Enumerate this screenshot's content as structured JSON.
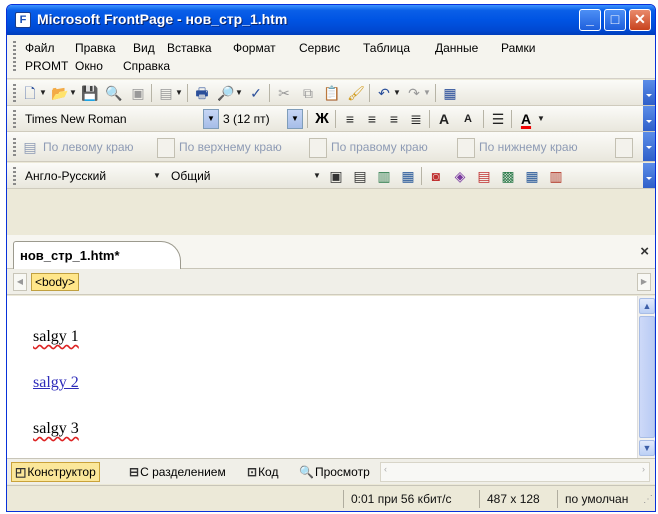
{
  "window": {
    "title": "Microsoft FrontPage - нов_стр_1.htm",
    "app_icon_letter": "F",
    "minimize": "_",
    "maximize": "□",
    "close": "✕"
  },
  "menu": {
    "items": [
      "Файл",
      "Правка",
      "Вид",
      "Вставка",
      "Формат",
      "Сервис",
      "Таблица",
      "Данные",
      "Рамки",
      "PROMT",
      "Окно",
      "Справка"
    ]
  },
  "formatting": {
    "font": "Times New Roman",
    "size": "3  (12 пт)",
    "bold": "Ж",
    "grow_font": "A",
    "shrink_font": "A",
    "font_color": "A"
  },
  "margins": {
    "left": "По левому краю",
    "top": "По верхнему краю",
    "right": "По правому краю",
    "bottom": "По нижнему краю"
  },
  "translation": {
    "direction": "Англо-Русский",
    "subject": "Общий"
  },
  "document": {
    "tab_label": "нов_стр_1.htm*",
    "close": "×",
    "tag": "<body>",
    "paragraphs": [
      "salgy 1",
      "salgy 2",
      "salgy 3"
    ]
  },
  "views": {
    "design": "Конструктор",
    "split": "С разделением",
    "code": "Код",
    "preview": "Просмотр"
  },
  "status": {
    "download_time": "0:01 при 56 кбит/с",
    "page_size": "487 x 128",
    "default": "по умолчан"
  },
  "colors": {
    "title_bar": "#0054e3",
    "active_view_tab": "#fbe79a",
    "tag_highlight": "#ffe68a",
    "link": "#2d2bba"
  }
}
